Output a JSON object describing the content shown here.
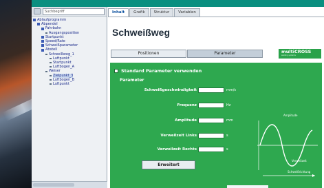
{
  "tree": {
    "search_placeholder": "Suchbegriff",
    "nodes": [
      {
        "label": "Ablaufprogramm",
        "level": 0
      },
      {
        "label": "Abpendel",
        "level": 1
      },
      {
        "label": "Fahrbahn",
        "level": 2
      },
      {
        "label": "Ausgangsposition",
        "level": 3
      },
      {
        "label": "Startpunkt",
        "level": 2
      },
      {
        "label": "Speed/Rate",
        "level": 2
      },
      {
        "label": "Schweißparameter",
        "level": 2
      },
      {
        "label": "Abstell",
        "level": 2
      },
      {
        "label": "Schweißweg_1",
        "level": 3
      },
      {
        "label": "Luftpunkt",
        "level": 4
      },
      {
        "label": "Startpunkt",
        "level": 4
      },
      {
        "label": "Luftbogen_A",
        "level": 4
      },
      {
        "label": "Weiser",
        "level": 3
      },
      {
        "label": "Zielpunkt_3",
        "level": 4
      },
      {
        "label": "Luftbogen_B",
        "level": 4
      },
      {
        "label": "Luftpunkt",
        "level": 4
      }
    ]
  },
  "tabs": [
    "Inhalt",
    "Grafik",
    "Struktur",
    "Variablen"
  ],
  "page": {
    "title": "Schweißweg",
    "subtabs": [
      "Positionen",
      "Parameter"
    ],
    "logo": "multiCROSS",
    "logo_tag": "welding systems"
  },
  "panel": {
    "standard_label": "Standard Parameter verwenden",
    "params_label": "Parameter",
    "rows": [
      {
        "label": "Schweißgeschwindigkeit",
        "unit": "mm/s"
      },
      {
        "label": "Frequenz",
        "unit": "Hz"
      },
      {
        "label": "Amplitude",
        "unit": "mm"
      },
      {
        "label": "Verweilzeit Links",
        "unit": "s"
      },
      {
        "label": "Verweilzeit Rechts",
        "unit": "s"
      }
    ],
    "extended_button": "Erweitert"
  },
  "wave": {
    "label_top": "Amplitude",
    "label_mid": "Verweilzeit",
    "label_bottom": "Schweißrichtung"
  },
  "colors": {
    "panel_green": "#2ea84f",
    "accent_teal": "#0a8f80",
    "tab_active_text": "#0a4f9e"
  }
}
